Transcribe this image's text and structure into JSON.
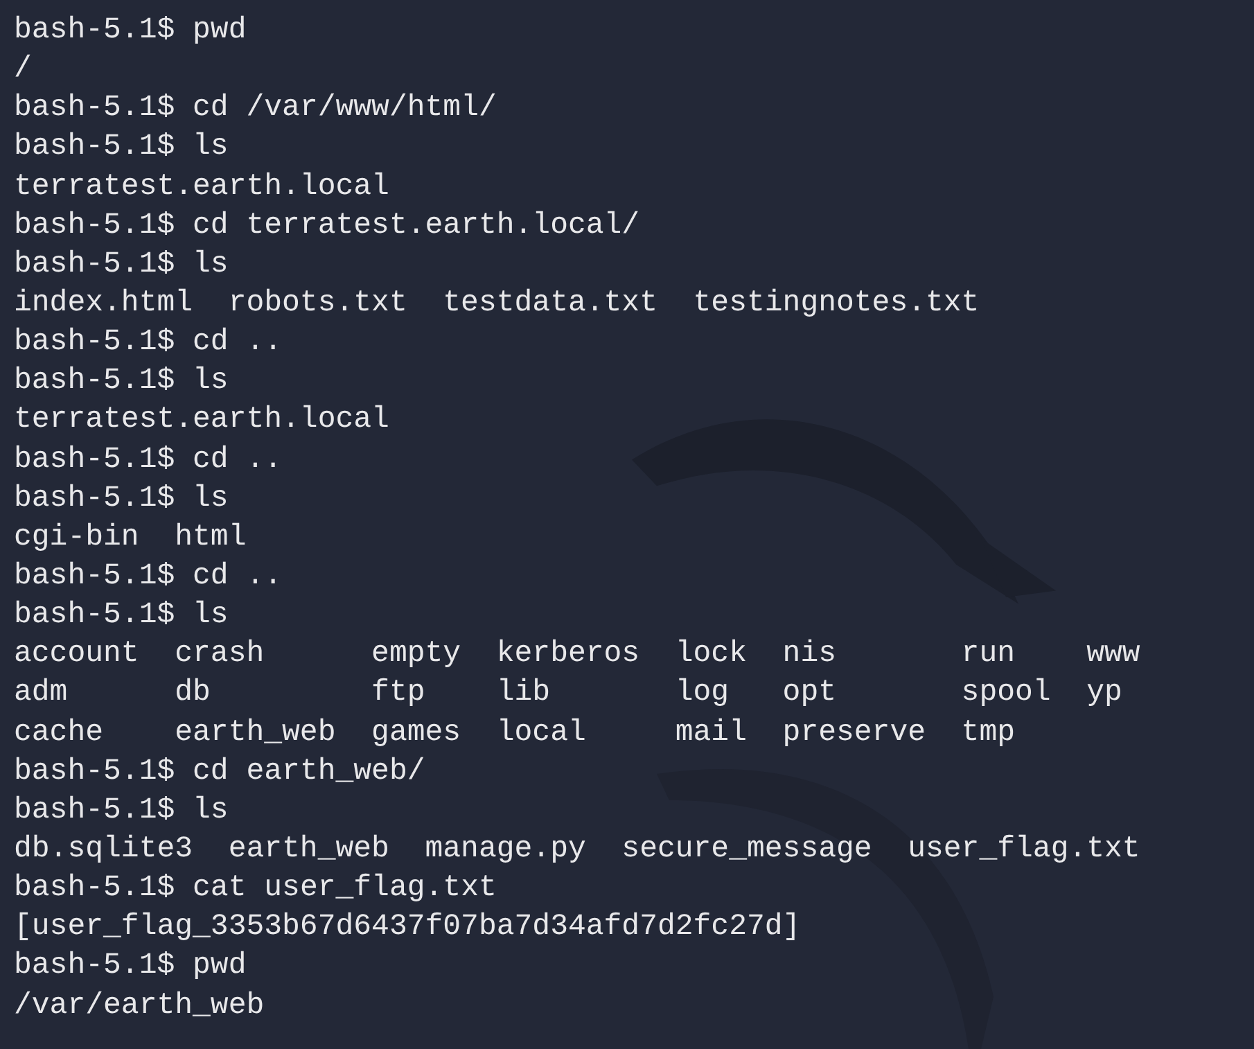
{
  "terminal": {
    "lines": [
      {
        "kind": "command",
        "prompt": "bash-5.1$",
        "command": "pwd"
      },
      {
        "kind": "output",
        "text": "/"
      },
      {
        "kind": "command",
        "prompt": "bash-5.1$",
        "command": "cd /var/www/html/"
      },
      {
        "kind": "command",
        "prompt": "bash-5.1$",
        "command": "ls"
      },
      {
        "kind": "output",
        "text": "terratest.earth.local"
      },
      {
        "kind": "command",
        "prompt": "bash-5.1$",
        "command": "cd terratest.earth.local/"
      },
      {
        "kind": "command",
        "prompt": "bash-5.1$",
        "command": "ls"
      },
      {
        "kind": "output",
        "text": "index.html  robots.txt  testdata.txt  testingnotes.txt"
      },
      {
        "kind": "command",
        "prompt": "bash-5.1$",
        "command": "cd .."
      },
      {
        "kind": "command",
        "prompt": "bash-5.1$",
        "command": "ls"
      },
      {
        "kind": "output",
        "text": "terratest.earth.local"
      },
      {
        "kind": "command",
        "prompt": "bash-5.1$",
        "command": "cd .."
      },
      {
        "kind": "command",
        "prompt": "bash-5.1$",
        "command": "ls"
      },
      {
        "kind": "output",
        "text": "cgi-bin  html"
      },
      {
        "kind": "command",
        "prompt": "bash-5.1$",
        "command": "cd .."
      },
      {
        "kind": "command",
        "prompt": "bash-5.1$",
        "command": "ls"
      },
      {
        "kind": "output",
        "text": "account  crash      empty  kerberos  lock  nis       run    www"
      },
      {
        "kind": "output",
        "text": "adm      db         ftp    lib       log   opt       spool  yp"
      },
      {
        "kind": "output",
        "text": "cache    earth_web  games  local     mail  preserve  tmp"
      },
      {
        "kind": "command",
        "prompt": "bash-5.1$",
        "command": "cd earth_web/"
      },
      {
        "kind": "command",
        "prompt": "bash-5.1$",
        "command": "ls"
      },
      {
        "kind": "output",
        "text": "db.sqlite3  earth_web  manage.py  secure_message  user_flag.txt"
      },
      {
        "kind": "command",
        "prompt": "bash-5.1$",
        "command": "cat user_flag.txt"
      },
      {
        "kind": "output",
        "text": "[user_flag_3353b67d6437f07ba7d34afd7d2fc27d]"
      },
      {
        "kind": "command",
        "prompt": "bash-5.1$",
        "command": "pwd"
      },
      {
        "kind": "output",
        "text": "/var/earth_web"
      }
    ]
  }
}
